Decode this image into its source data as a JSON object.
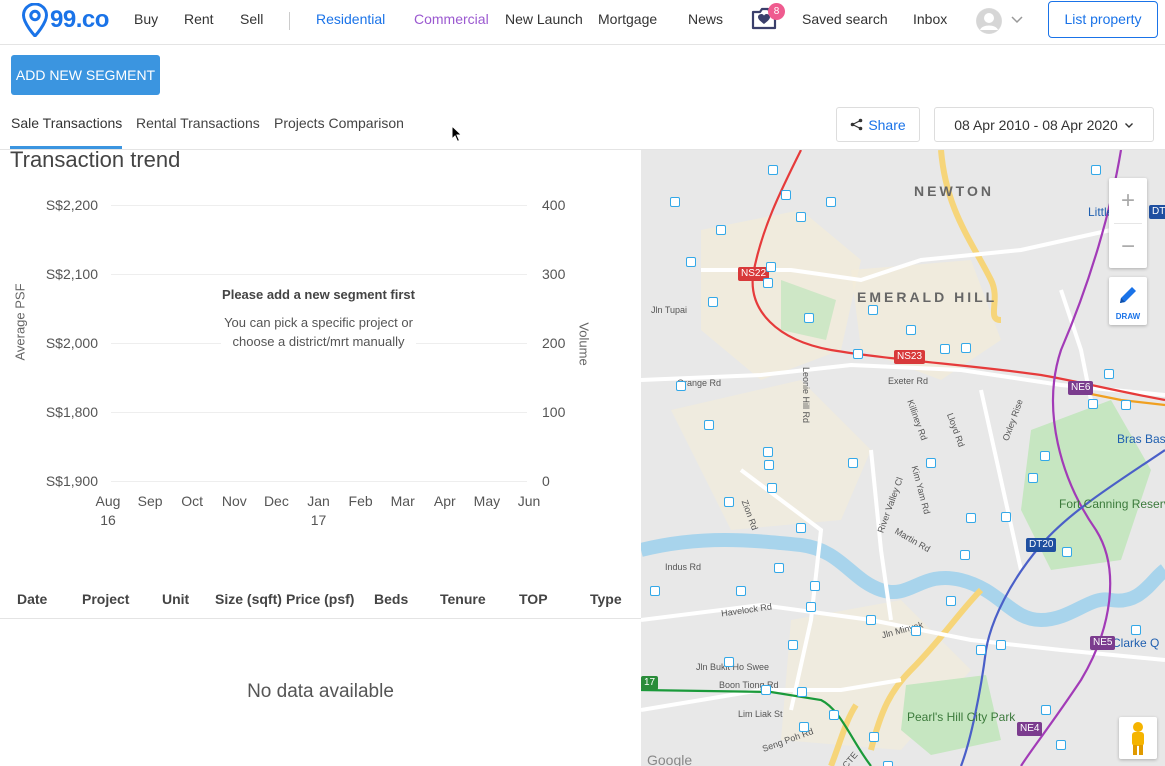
{
  "nav": {
    "logo": "99.co",
    "links": [
      "Buy",
      "Rent",
      "Sell"
    ],
    "segments": [
      "Residential",
      "Commercial"
    ],
    "extra": [
      "New Launch",
      "Mortgage",
      "News"
    ],
    "shortlist_count": "8",
    "saved_search": "Saved search",
    "inbox": "Inbox",
    "list_property": "List property"
  },
  "toolbar": {
    "add_segment": "ADD NEW SEGMENT",
    "tabs": [
      "Sale Transactions",
      "Rental Transactions",
      "Projects Comparison"
    ],
    "share": "Share",
    "date_range": "08 Apr 2010 - 08 Apr 2020"
  },
  "trend": {
    "title": "Transaction trend",
    "empty_title": "Please add a new segment first",
    "empty_sub": "You can pick a specific project or choose a district/mrt manually"
  },
  "chart_data": {
    "type": "line",
    "title": "",
    "ylabel": "Average PSF",
    "y2label": "Volume",
    "y_ticks": [
      "S$2,200",
      "S$2,100",
      "S$2,000",
      "S$1,800",
      "S$1,900"
    ],
    "y2_ticks": [
      "400",
      "300",
      "200",
      "100",
      "0"
    ],
    "x": [
      "Aug 16",
      "Sep",
      "Oct",
      "Nov",
      "Dec",
      "Jan 17",
      "Feb",
      "Mar",
      "Apr",
      "May",
      "Jun"
    ],
    "series": []
  },
  "table": {
    "columns": [
      "Date",
      "Project",
      "Unit",
      "Size (sqft)",
      "Price (psf)",
      "Beds",
      "Tenure",
      "TOP",
      "Type"
    ],
    "empty": "No data available"
  },
  "map": {
    "areas": [
      "NEWTON",
      "EMERALD HILL"
    ],
    "roads": [
      "Grange Rd",
      "Exeter Rd",
      "Zion Rd",
      "Havelock Rd",
      "Jln Bukit Ho Swee",
      "Boon Tiong Rd",
      "Indus Rd",
      "Jln Tupai",
      "Kim Yam Rd",
      "River Valley Cl",
      "Martin Rd",
      "Lloyd Rd",
      "Killiney Rd",
      "Oxley Rise",
      "Leonie Hill Rd",
      "Jln Minyak",
      "Lim Liak St",
      "Seng Poh Rd",
      "CTE"
    ],
    "parks": [
      "Fort Canning Reservoir",
      "Pearl's Hill City Park"
    ],
    "places": [
      "Bras Basa",
      "Clarke Q",
      "Little"
    ],
    "stations": [
      "NS22",
      "NS23",
      "NE6",
      "DT20",
      "NE5",
      "NE4",
      "DT",
      "17"
    ],
    "draw_label": "DRAW",
    "zoom_in": "+",
    "zoom_out": "−",
    "attribution": "Google"
  }
}
